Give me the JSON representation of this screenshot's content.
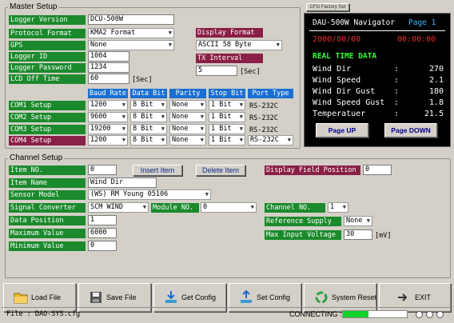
{
  "master": {
    "title": "Master Setup",
    "logger_version_label": "Logger Version",
    "logger_version": "DCU-500W",
    "protocol_label": "Protocol Format",
    "protocol": "KMA2 Format",
    "gps_label": "GPS",
    "gps": "None",
    "logger_id_label": "Logger ID",
    "logger_id": "1004",
    "password_label": "Logger Password",
    "password": "1234",
    "lcd_label": "LCD Off Time",
    "lcd": "60",
    "lcd_unit": "[Sec]",
    "display_format_label": "Display Format",
    "display_format": "ASCII 58 Byte",
    "tx_interval_label": "TX Interval",
    "tx_interval": "5",
    "tx_unit": "[Sec]",
    "com_headers": [
      "Baud Rate",
      "Data Bit",
      "Parity",
      "Stop Bit",
      "Port Type"
    ],
    "com_rows": [
      {
        "label": "COM1 Setup",
        "baud": "1200",
        "data": "8 Bit",
        "parity": "None",
        "stop": "1 Bit",
        "port": "RS-232C"
      },
      {
        "label": "COM2 Setup",
        "baud": "9600",
        "data": "8 Bit",
        "parity": "None",
        "stop": "1 Bit",
        "port": "RS-232C"
      },
      {
        "label": "COM3 Setup",
        "baud": "19200",
        "data": "8 Bit",
        "parity": "None",
        "stop": "1 Bit",
        "port": "RS-232C"
      },
      {
        "label": "COM4 Setup",
        "baud": "1200",
        "data": "8 Bit",
        "parity": "None",
        "stop": "1 Bit",
        "port": "RS-232C"
      }
    ]
  },
  "navigator": {
    "factory_button": "CFG Factory Set",
    "title": "DAU-500W Navigator",
    "page": "Page 1",
    "date": "2000/00/00",
    "time": "00:00:00",
    "section": "REAL TIME DATA",
    "rows": [
      {
        "name": "Wind Dir",
        "value": "270"
      },
      {
        "name": "Wind Speed",
        "value": "2.1"
      },
      {
        "name": "Wind Dir Gust",
        "value": "180"
      },
      {
        "name": "Wind Speed Gust",
        "value": "1.8"
      },
      {
        "name": "Temperatuer",
        "value": "21.5"
      }
    ],
    "page_up": "Page UP",
    "page_down": "Page DOWN"
  },
  "channel": {
    "title": "Channel Setup",
    "item_no_label": "Item NO.",
    "item_no": "0",
    "insert_item": "Insert Item",
    "delete_item": "Delete Item",
    "display_field_label": "Display Field Position",
    "display_field": "0",
    "item_name_label": "Item Name",
    "item_name": "Wind Dir",
    "sensor_model_label": "Sensor Model",
    "sensor_model": "(WS) RM Young 05106",
    "signal_converter_label": "Signal Converter",
    "signal_converter": "SCM WIND",
    "module_no_label": "Module NO.",
    "module_no": "0",
    "channel_no_label": "Channel NO.",
    "channel_no": "1",
    "data_position_label": "Data Position",
    "data_position": "1",
    "reference_supply_label": "Reference Supply",
    "reference_supply": "None",
    "maximum_value_label": "Maximum Value",
    "maximum_value": "6000",
    "max_input_voltage_label": "Max Input Voltage",
    "max_input_voltage": "30",
    "voltage_unit": "[mV]",
    "minimum_value_label": "Minimum Value",
    "minimum_value": "0"
  },
  "toolbar": {
    "load_file": "Load File",
    "save_file": "Save File",
    "get_config": "Get Config",
    "set_config": "Set Config",
    "system_reset": "System Reset",
    "exit": "EXIT"
  },
  "status": {
    "file": "File : DAO-SYS.cfg",
    "connecting": "CONNECTING :",
    "progress": 0.4
  },
  "colors": {
    "label_green": "#1b8a2c",
    "label_maroon": "#8a1f47",
    "header_blue": "#1b6fd1",
    "lcd_red": "#e03030",
    "lcd_green": "#33ff33"
  }
}
